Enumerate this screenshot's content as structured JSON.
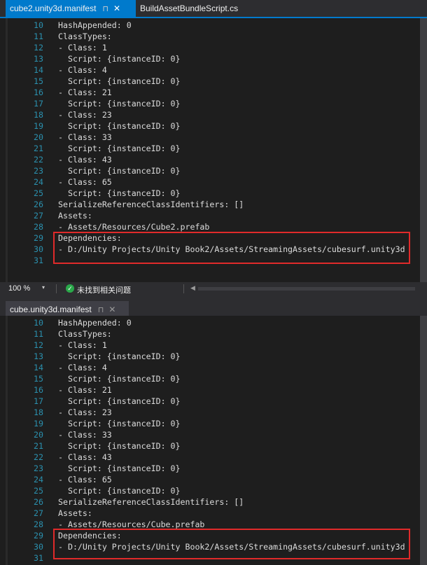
{
  "tabbar_top": {
    "tabs": [
      {
        "label": "cube2.unity3d.manifest",
        "pin": "⊓",
        "close": "✕"
      },
      {
        "label": "BuildAssetBundleScript.cs"
      }
    ]
  },
  "pane1": {
    "lines": [
      {
        "num": "10",
        "text": "HashAppended: 0"
      },
      {
        "num": "11",
        "text": "ClassTypes:"
      },
      {
        "num": "12",
        "text": "- Class: 1"
      },
      {
        "num": "13",
        "text": "  Script: {instanceID: 0}"
      },
      {
        "num": "14",
        "text": "- Class: 4"
      },
      {
        "num": "15",
        "text": "  Script: {instanceID: 0}"
      },
      {
        "num": "16",
        "text": "- Class: 21"
      },
      {
        "num": "17",
        "text": "  Script: {instanceID: 0}"
      },
      {
        "num": "18",
        "text": "- Class: 23"
      },
      {
        "num": "19",
        "text": "  Script: {instanceID: 0}"
      },
      {
        "num": "20",
        "text": "- Class: 33"
      },
      {
        "num": "21",
        "text": "  Script: {instanceID: 0}"
      },
      {
        "num": "22",
        "text": "- Class: 43"
      },
      {
        "num": "23",
        "text": "  Script: {instanceID: 0}"
      },
      {
        "num": "24",
        "text": "- Class: 65"
      },
      {
        "num": "25",
        "text": "  Script: {instanceID: 0}"
      },
      {
        "num": "26",
        "text": "SerializeReferenceClassIdentifiers: []"
      },
      {
        "num": "27",
        "text": "Assets:"
      },
      {
        "num": "28",
        "text": "- Assets/Resources/Cube2.prefab"
      },
      {
        "num": "29",
        "text": "Dependencies:"
      },
      {
        "num": "30",
        "text": "- D:/Unity Projects/Unity Book2/Assets/StreamingAssets/cubesurf.unity3d"
      },
      {
        "num": "31",
        "text": ""
      }
    ]
  },
  "statusbar": {
    "zoom": "100 %",
    "zoom_arrow": "▾",
    "ok_icon": "✓",
    "message": "未找到相关问题",
    "scroll_left": "◀"
  },
  "tabbar_bottom": {
    "tabs": [
      {
        "label": "cube.unity3d.manifest",
        "pin": "⊓",
        "close": "✕"
      }
    ]
  },
  "pane2": {
    "lines": [
      {
        "num": "10",
        "text": "HashAppended: 0"
      },
      {
        "num": "11",
        "text": "ClassTypes:"
      },
      {
        "num": "12",
        "text": "- Class: 1"
      },
      {
        "num": "13",
        "text": "  Script: {instanceID: 0}"
      },
      {
        "num": "14",
        "text": "- Class: 4"
      },
      {
        "num": "15",
        "text": "  Script: {instanceID: 0}"
      },
      {
        "num": "16",
        "text": "- Class: 21"
      },
      {
        "num": "17",
        "text": "  Script: {instanceID: 0}"
      },
      {
        "num": "18",
        "text": "- Class: 23"
      },
      {
        "num": "19",
        "text": "  Script: {instanceID: 0}"
      },
      {
        "num": "20",
        "text": "- Class: 33"
      },
      {
        "num": "21",
        "text": "  Script: {instanceID: 0}"
      },
      {
        "num": "22",
        "text": "- Class: 43"
      },
      {
        "num": "23",
        "text": "  Script: {instanceID: 0}"
      },
      {
        "num": "24",
        "text": "- Class: 65"
      },
      {
        "num": "25",
        "text": "  Script: {instanceID: 0}"
      },
      {
        "num": "26",
        "text": "SerializeReferenceClassIdentifiers: []"
      },
      {
        "num": "27",
        "text": "Assets:"
      },
      {
        "num": "28",
        "text": "- Assets/Resources/Cube.prefab"
      },
      {
        "num": "29",
        "text": "Dependencies:"
      },
      {
        "num": "30",
        "text": "- D:/Unity Projects/Unity Book2/Assets/StreamingAssets/cubesurf.unity3d"
      },
      {
        "num": "31",
        "text": ""
      }
    ]
  },
  "colors": {
    "active_tab": "#007acc",
    "line_number": "#2b91af",
    "highlight_box": "#e02a2a"
  }
}
